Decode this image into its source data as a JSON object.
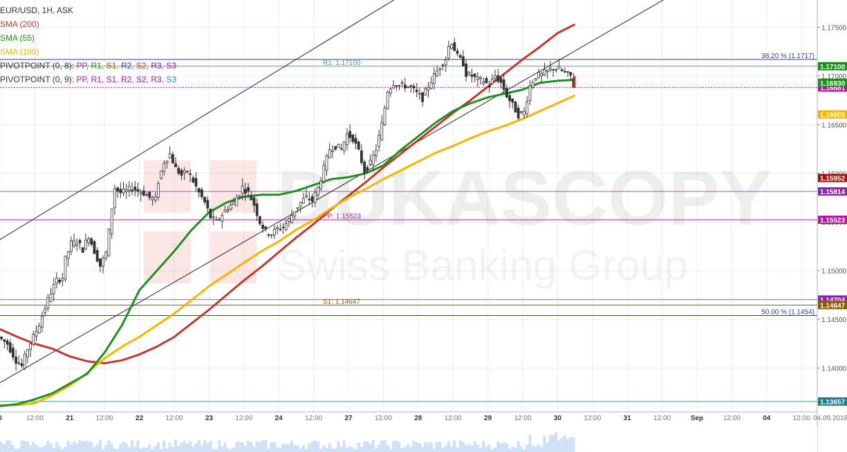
{
  "header": {
    "symbol": "EUR/USD, 1H, ASK",
    "indicators": [
      {
        "label": "SMA (200)",
        "color": "#c0392b"
      },
      {
        "label": "SMA (55)",
        "color": "#1e8f1e"
      },
      {
        "label": "SMA (100)",
        "color": "#f5b400"
      }
    ],
    "pivots": [
      {
        "label": "PIVOTPOINT (0, 8):",
        "items": [
          {
            "text": "PP,",
            "color": "#b5179e"
          },
          {
            "text": "R1,",
            "color": "#1e8f1e"
          },
          {
            "text": "S1,",
            "color": "#8a5a00"
          },
          {
            "text": "R2,",
            "color": "#2c3e9e"
          },
          {
            "text": "S2,",
            "color": "#c0392b"
          },
          {
            "text": "R3,",
            "color": "#7b1fa2"
          },
          {
            "text": "S3",
            "color": "#b5179e"
          }
        ]
      },
      {
        "label": "PIVOTPOINT (0, 9):",
        "items": [
          {
            "text": "PP,",
            "color": "#b5179e"
          },
          {
            "text": "R1,",
            "color": "#b5179e"
          },
          {
            "text": "S1,",
            "color": "#b5179e"
          },
          {
            "text": "R2,",
            "color": "#b5179e"
          },
          {
            "text": "S2,",
            "color": "#b5179e"
          },
          {
            "text": "R3,",
            "color": "#b5179e"
          },
          {
            "text": "S3",
            "color": "#2196c0"
          }
        ]
      }
    ]
  },
  "watermark": {
    "brand": "DUKASCOPY",
    "tagline": "Swiss Banking Group"
  },
  "chart_data": {
    "type": "candlestick",
    "ylim": [
      1.1355,
      1.1778
    ],
    "y_ticks": [
      {
        "value": 1.175,
        "label": "1.17500"
      },
      {
        "value": 1.17,
        "label": "1.17000"
      },
      {
        "value": 1.165,
        "label": "1.16500"
      },
      {
        "value": 1.16,
        "label": "1.16000"
      },
      {
        "value": 1.155,
        "label": "1.15500"
      },
      {
        "value": 1.15,
        "label": "1.15000"
      },
      {
        "value": 1.145,
        "label": "1.14500"
      },
      {
        "value": 1.14,
        "label": "1.14000"
      }
    ],
    "x_ticks": [
      {
        "bar": 0,
        "label": "0"
      },
      {
        "bar": 12,
        "label": "12:00"
      },
      {
        "bar": 24,
        "label": "21"
      },
      {
        "bar": 36,
        "label": "12:00"
      },
      {
        "bar": 48,
        "label": "22"
      },
      {
        "bar": 60,
        "label": "12:00"
      },
      {
        "bar": 72,
        "label": "23"
      },
      {
        "bar": 84,
        "label": "12:00"
      },
      {
        "bar": 96,
        "label": "24"
      },
      {
        "bar": 108,
        "label": "12:00"
      },
      {
        "bar": 120,
        "label": "27"
      },
      {
        "bar": 132,
        "label": "12:00"
      },
      {
        "bar": 144,
        "label": "28"
      },
      {
        "bar": 156,
        "label": "12:00"
      },
      {
        "bar": 168,
        "label": "29"
      },
      {
        "bar": 180,
        "label": "12:00"
      },
      {
        "bar": 192,
        "label": "30"
      },
      {
        "bar": 204,
        "label": "12:00"
      },
      {
        "bar": 216,
        "label": "31"
      },
      {
        "bar": 228,
        "label": "12:00"
      },
      {
        "bar": 240,
        "label": "Sep"
      },
      {
        "bar": 252,
        "label": "12:00"
      },
      {
        "bar": 264,
        "label": "04"
      },
      {
        "bar": 276,
        "label": "12:00"
      },
      {
        "bar": 286,
        "label": "04.09.2018"
      }
    ],
    "series_path": [
      [
        0,
        1.1432
      ],
      [
        3,
        1.1425
      ],
      [
        6,
        1.1408
      ],
      [
        8,
        1.1402
      ],
      [
        10,
        1.142
      ],
      [
        12,
        1.1432
      ],
      [
        14,
        1.1445
      ],
      [
        16,
        1.1462
      ],
      [
        18,
        1.1478
      ],
      [
        20,
        1.149
      ],
      [
        22,
        1.1493
      ],
      [
        23,
        1.1512
      ],
      [
        25,
        1.1528
      ],
      [
        27,
        1.153
      ],
      [
        29,
        1.1522
      ],
      [
        31,
        1.1536
      ],
      [
        33,
        1.152
      ],
      [
        35,
        1.1505
      ],
      [
        37,
        1.1518
      ],
      [
        38,
        1.154
      ],
      [
        39,
        1.1565
      ],
      [
        40,
        1.1585
      ],
      [
        42,
        1.158
      ],
      [
        44,
        1.1582
      ],
      [
        46,
        1.1585
      ],
      [
        48,
        1.1582
      ],
      [
        50,
        1.158
      ],
      [
        52,
        1.1575
      ],
      [
        54,
        1.1573
      ],
      [
        55,
        1.1592
      ],
      [
        57,
        1.1612
      ],
      [
        59,
        1.162
      ],
      [
        61,
        1.1605
      ],
      [
        63,
        1.1598
      ],
      [
        65,
        1.1602
      ],
      [
        67,
        1.1592
      ],
      [
        69,
        1.158
      ],
      [
        71,
        1.157
      ],
      [
        73,
        1.1555
      ],
      [
        75,
        1.155
      ],
      [
        77,
        1.1558
      ],
      [
        79,
        1.1565
      ],
      [
        81,
        1.157
      ],
      [
        83,
        1.158
      ],
      [
        84,
        1.1586
      ],
      [
        86,
        1.158
      ],
      [
        88,
        1.1568
      ],
      [
        90,
        1.155
      ],
      [
        92,
        1.154
      ],
      [
        94,
        1.1538
      ],
      [
        96,
        1.1543
      ],
      [
        98,
        1.1545
      ],
      [
        100,
        1.1552
      ],
      [
        102,
        1.1562
      ],
      [
        104,
        1.157
      ],
      [
        106,
        1.1575
      ],
      [
        108,
        1.1572
      ],
      [
        110,
        1.1585
      ],
      [
        112,
        1.1605
      ],
      [
        114,
        1.1625
      ],
      [
        116,
        1.1628
      ],
      [
        118,
        1.1625
      ],
      [
        120,
        1.164
      ],
      [
        122,
        1.1636
      ],
      [
        124,
        1.1622
      ],
      [
        126,
        1.1603
      ],
      [
        128,
        1.161
      ],
      [
        130,
        1.1625
      ],
      [
        132,
        1.165
      ],
      [
        134,
        1.1685
      ],
      [
        136,
        1.1693
      ],
      [
        138,
        1.169
      ],
      [
        140,
        1.169
      ],
      [
        142,
        1.1688
      ],
      [
        144,
        1.1682
      ],
      [
        146,
        1.1677
      ],
      [
        148,
        1.169
      ],
      [
        150,
        1.17
      ],
      [
        152,
        1.171
      ],
      [
        154,
        1.1718
      ],
      [
        155,
        1.173
      ],
      [
        156,
        1.1735
      ],
      [
        158,
        1.172
      ],
      [
        160,
        1.1713
      ],
      [
        161,
        1.1702
      ],
      [
        163,
        1.17
      ],
      [
        165,
        1.1696
      ],
      [
        167,
        1.1695
      ],
      [
        169,
        1.169
      ],
      [
        171,
        1.17
      ],
      [
        173,
        1.1693
      ],
      [
        175,
        1.168
      ],
      [
        177,
        1.167
      ],
      [
        179,
        1.166
      ],
      [
        181,
        1.1663
      ],
      [
        183,
        1.169
      ],
      [
        185,
        1.17
      ],
      [
        187,
        1.1701
      ],
      [
        189,
        1.1705
      ],
      [
        191,
        1.1708
      ],
      [
        193,
        1.1707
      ],
      [
        195,
        1.1703
      ],
      [
        197,
        1.17
      ],
      [
        198,
        1.169
      ]
    ],
    "sma_55": [
      [
        0,
        1.1361
      ],
      [
        6,
        1.1363
      ],
      [
        12,
        1.1368
      ],
      [
        18,
        1.1374
      ],
      [
        24,
        1.1384
      ],
      [
        30,
        1.1394
      ],
      [
        36,
        1.1416
      ],
      [
        42,
        1.1444
      ],
      [
        48,
        1.148
      ],
      [
        54,
        1.15
      ],
      [
        60,
        1.152
      ],
      [
        66,
        1.1542
      ],
      [
        72,
        1.156
      ],
      [
        78,
        1.157
      ],
      [
        84,
        1.1576
      ],
      [
        90,
        1.1578
      ],
      [
        96,
        1.1578
      ],
      [
        102,
        1.1582
      ],
      [
        108,
        1.1588
      ],
      [
        114,
        1.1594
      ],
      [
        120,
        1.1596
      ],
      [
        126,
        1.16
      ],
      [
        132,
        1.1608
      ],
      [
        138,
        1.1624
      ],
      [
        144,
        1.1638
      ],
      [
        150,
        1.1652
      ],
      [
        156,
        1.1664
      ],
      [
        162,
        1.1672
      ],
      [
        168,
        1.1678
      ],
      [
        174,
        1.1682
      ],
      [
        180,
        1.1686
      ],
      [
        186,
        1.1693
      ],
      [
        192,
        1.1695
      ],
      [
        198,
        1.1696
      ]
    ],
    "sma_100": [
      [
        0,
        1.1362
      ],
      [
        6,
        1.1362
      ],
      [
        12,
        1.1364
      ],
      [
        18,
        1.1372
      ],
      [
        24,
        1.1382
      ],
      [
        30,
        1.1395
      ],
      [
        36,
        1.141
      ],
      [
        42,
        1.1422
      ],
      [
        48,
        1.1432
      ],
      [
        54,
        1.1444
      ],
      [
        60,
        1.1456
      ],
      [
        66,
        1.147
      ],
      [
        72,
        1.1484
      ],
      [
        78,
        1.1496
      ],
      [
        84,
        1.1508
      ],
      [
        90,
        1.152
      ],
      [
        96,
        1.153
      ],
      [
        102,
        1.1542
      ],
      [
        108,
        1.1552
      ],
      [
        114,
        1.1564
      ],
      [
        120,
        1.1575
      ],
      [
        126,
        1.1584
      ],
      [
        132,
        1.1594
      ],
      [
        138,
        1.1603
      ],
      [
        144,
        1.1612
      ],
      [
        150,
        1.1621
      ],
      [
        156,
        1.1628
      ],
      [
        162,
        1.1636
      ],
      [
        168,
        1.1643
      ],
      [
        174,
        1.1649
      ],
      [
        180,
        1.1656
      ],
      [
        186,
        1.1664
      ],
      [
        192,
        1.1672
      ],
      [
        198,
        1.168
      ]
    ],
    "sma_200": [
      [
        0,
        1.144
      ],
      [
        6,
        1.1432
      ],
      [
        12,
        1.1425
      ],
      [
        18,
        1.142
      ],
      [
        24,
        1.1412
      ],
      [
        30,
        1.1407
      ],
      [
        36,
        1.1405
      ],
      [
        42,
        1.1408
      ],
      [
        48,
        1.1414
      ],
      [
        54,
        1.1422
      ],
      [
        60,
        1.1432
      ],
      [
        66,
        1.1446
      ],
      [
        72,
        1.146
      ],
      [
        78,
        1.1475
      ],
      [
        84,
        1.149
      ],
      [
        90,
        1.1504
      ],
      [
        96,
        1.1519
      ],
      [
        102,
        1.1534
      ],
      [
        108,
        1.1548
      ],
      [
        114,
        1.1563
      ],
      [
        120,
        1.1577
      ],
      [
        126,
        1.1591
      ],
      [
        132,
        1.1606
      ],
      [
        138,
        1.162
      ],
      [
        144,
        1.1634
      ],
      [
        150,
        1.1648
      ],
      [
        156,
        1.1662
      ],
      [
        162,
        1.1675
      ],
      [
        168,
        1.1689
      ],
      [
        174,
        1.1703
      ],
      [
        180,
        1.1717
      ],
      [
        186,
        1.173
      ],
      [
        192,
        1.1744
      ],
      [
        198,
        1.1753
      ]
    ],
    "channel_lines": [
      {
        "name": "upper-channel",
        "from": [
          0,
          1.1532
        ],
        "to": [
          145,
          1.1795
        ]
      },
      {
        "name": "lower-channel",
        "from": [
          0,
          1.1385
        ],
        "to": [
          240,
          1.1798
        ]
      }
    ],
    "levels": [
      {
        "name": "r1-level",
        "value": 1.171,
        "color": "#3aa86b",
        "label": "R1: 1.17100",
        "label_at_bar": 110,
        "tag": "1.17100",
        "tag_color": "#1e8f1e"
      },
      {
        "name": "fib-38-level",
        "value": 1.1717,
        "color": "#2c3e9e",
        "label": "38.20 % (1.1717)",
        "label_at_bar": "right"
      },
      {
        "name": "current-price-level",
        "value": 1.16881,
        "color": "#b5179e",
        "dashed": true,
        "tag": "1.16881",
        "tag_color": "#b5179e"
      },
      {
        "name": "pp-level",
        "value": 1.15523,
        "color": "#b5179e",
        "label": "PP: 1.15523",
        "label_at_bar": 110,
        "tag": "1.15523",
        "tag_color": "#b5179e"
      },
      {
        "name": "level-115814",
        "value": 1.15814,
        "color": "#9b59b6",
        "tag": "1.15814",
        "tag_color": "#8e24aa"
      },
      {
        "name": "level-114704",
        "value": 1.14704,
        "color": "#9b59b6",
        "tag": "1.14704",
        "tag_color": "#8e24aa"
      },
      {
        "name": "s1-level",
        "value": 1.14647,
        "color": "#8a5a00",
        "label": "S1: 1.14647",
        "label_at_bar": 110,
        "tag": "1.14647",
        "tag_color": "#8a5a00"
      },
      {
        "name": "fib-50-level",
        "value": 1.1454,
        "color": "#2c3e9e",
        "label": "50.00 % (1.1454)",
        "label_at_bar": "right"
      },
      {
        "name": "level-113657",
        "value": 1.13657,
        "color": "#2a9d8f",
        "tag": "1.13657",
        "tag_color": "#1b7f8f"
      }
    ],
    "price_tags": [
      {
        "name": "sma55-tag",
        "value": 1.1693,
        "label": "1.16930",
        "color": "#1e8f1e"
      },
      {
        "name": "sma100-tag",
        "value": 1.16605,
        "label": "1.16605",
        "color": "#f5b400"
      },
      {
        "name": "sma200-tag",
        "value": 1.15952,
        "label": "1.15952",
        "color": "#a31515"
      }
    ]
  }
}
